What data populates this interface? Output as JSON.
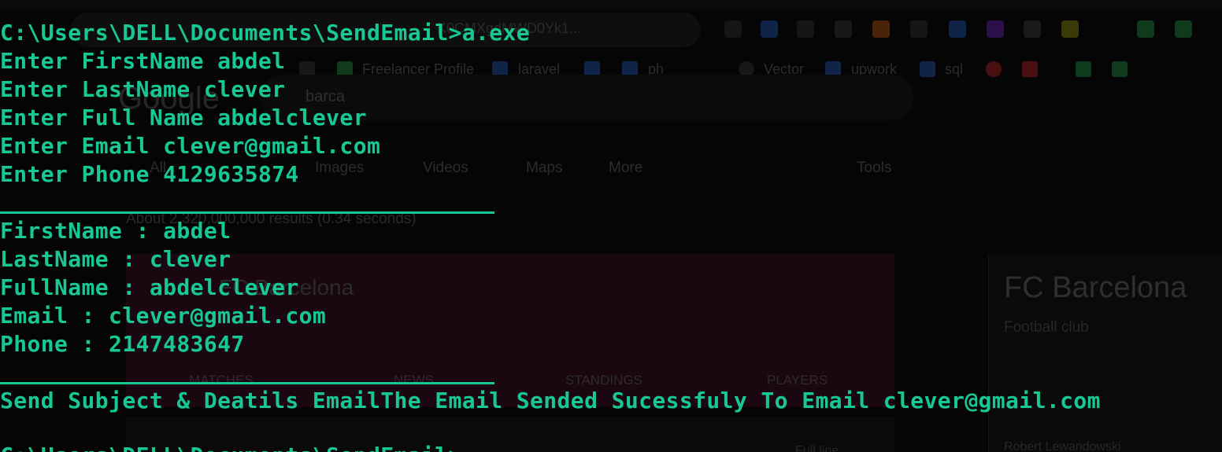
{
  "background_browser": {
    "address_text": "K0CMXgdMWD0Yk1...",
    "bookmarks": [
      "Freelancer Profile",
      "laravel",
      "ph",
      "Vector",
      "upwork",
      "sql"
    ],
    "search_logo": "Google",
    "search_query": "barca",
    "nav_items": [
      "All",
      "Images",
      "Videos",
      "Maps",
      "More",
      "Tools"
    ],
    "results_count": "About 2,320,000,000 results (0.34 seconds)",
    "result_title": "FC Barcelona",
    "card_tabs": [
      "MATCHES",
      "NEWS",
      "STANDINGS",
      "PLAYERS"
    ],
    "panel_title": "FC Barcelona",
    "panel_subtitle": "Football club",
    "panel_person": "Robert Lewandowski",
    "bottom_right_text": "Full line",
    "colors": {
      "card_bg": "#1b0710",
      "ext_red": "#4a1010",
      "ext_blue": "#0f2448",
      "ext_green": "#0f3a1c",
      "ext_orange": "#4a2408"
    }
  },
  "terminal": {
    "text_color": "#17c895",
    "prompt_command": "C:\\Users\\DELL\\Documents\\SendEmail>a.exe",
    "inputs": {
      "first_name": "Enter FirstName abdel",
      "last_name": "Enter LastName clever",
      "full_name": "Enter Full Name abdelclever",
      "email": "Enter Email clever@gmail.com",
      "phone": "Enter Phone 4129635874"
    },
    "outputs": {
      "first_name": "FirstName : abdel",
      "last_name": "LastName : clever",
      "full_name": "FullName : abdelclever",
      "email": "Email : clever@gmail.com",
      "phone": "Phone : 2147483647"
    },
    "send_status": "Send Subject & Deatils EmailThe Email Sended Sucessfuly To Email clever@gmail.com",
    "next_prompt": "C:\\Users\\DELL\\Documents\\SendEmail>"
  }
}
